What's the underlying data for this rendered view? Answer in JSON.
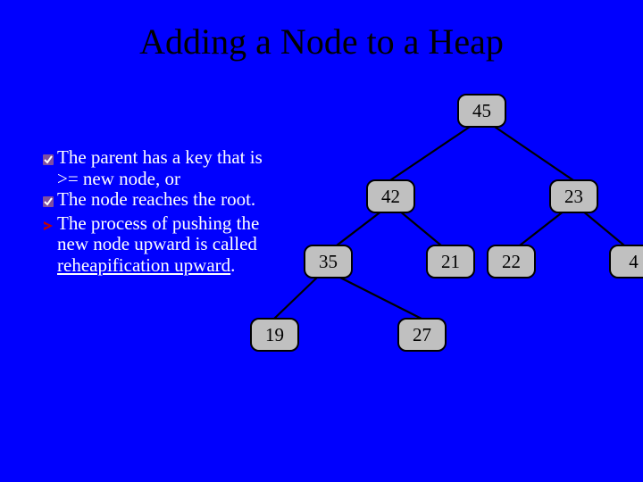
{
  "title": "Adding a Node to a Heap",
  "bullets": {
    "b1": "The parent has a  key that is >= new node, or",
    "b2": "The node reaches the root.",
    "b3a": "The process of pushing the new node upward is called ",
    "b3term": "reheapification upward",
    "b3b": "."
  },
  "icons": {
    "check": "check-icon",
    "arrow": "arrow-icon"
  },
  "chart_data": {
    "type": "tree",
    "title": "",
    "nodes": [
      {
        "id": "n45",
        "value": 45,
        "parent": null
      },
      {
        "id": "n42",
        "value": 42,
        "parent": "n45"
      },
      {
        "id": "n23",
        "value": 23,
        "parent": "n45"
      },
      {
        "id": "n35",
        "value": 35,
        "parent": "n42"
      },
      {
        "id": "n21",
        "value": 21,
        "parent": "n42"
      },
      {
        "id": "n22",
        "value": 22,
        "parent": "n23"
      },
      {
        "id": "n4",
        "value": 4,
        "parent": "n23"
      },
      {
        "id": "n19",
        "value": 19,
        "parent": "n35"
      },
      {
        "id": "n27",
        "value": 27,
        "parent": "n35"
      }
    ]
  }
}
